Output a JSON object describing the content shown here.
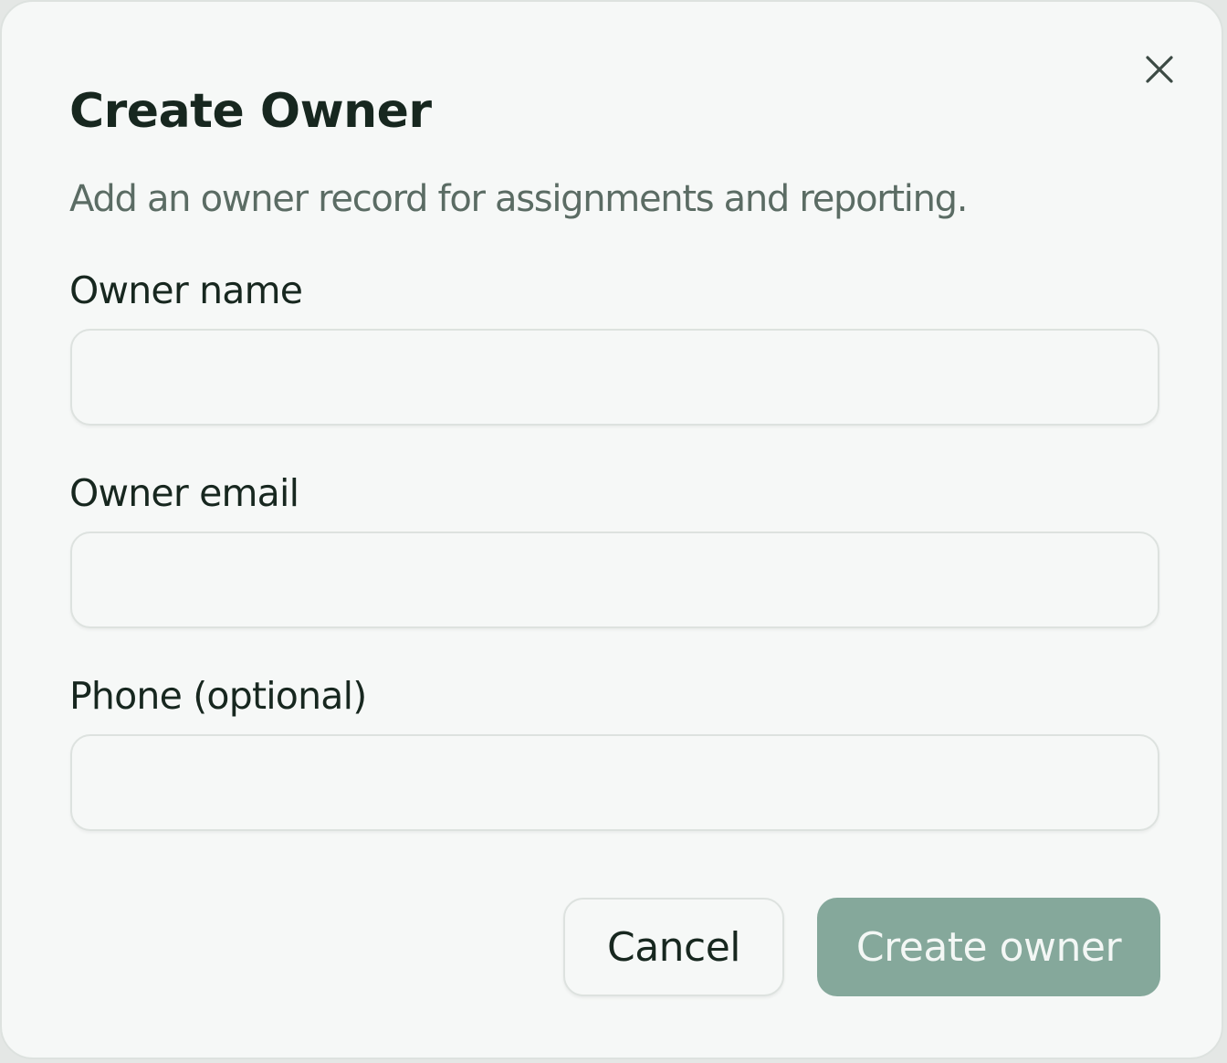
{
  "dialog": {
    "title": "Create Owner",
    "subtitle": "Add an owner record for assignments and reporting.",
    "close_icon": "close-icon"
  },
  "fields": {
    "owner_name": {
      "label": "Owner name",
      "value": "",
      "placeholder": ""
    },
    "owner_email": {
      "label": "Owner email",
      "value": "",
      "placeholder": ""
    },
    "phone": {
      "label": "Phone (optional)",
      "value": "",
      "placeholder": ""
    }
  },
  "actions": {
    "cancel_label": "Cancel",
    "create_label": "Create owner"
  },
  "colors": {
    "background": "#f6f8f7",
    "border": "#dde2df",
    "text_primary": "#17271f",
    "text_muted": "#5b6c64",
    "primary_button": "#85a89b",
    "primary_button_text": "#f3f7f5"
  }
}
